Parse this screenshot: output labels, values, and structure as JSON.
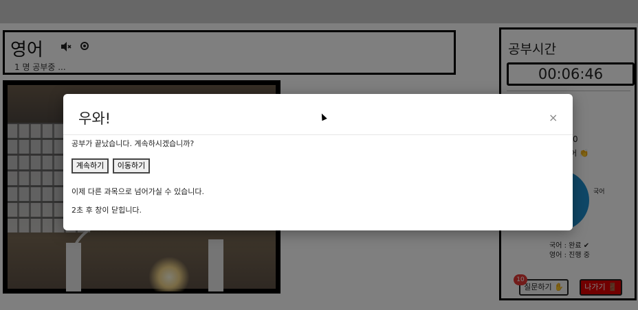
{
  "subject": {
    "title": "영어",
    "studying_count": "1 명 공부중 ..."
  },
  "right_panel": {
    "study_time_title": "공부시간",
    "timer": "00:06:46",
    "goal_number": "0",
    "goal_text": "어 👏",
    "pie_label": "국어",
    "legend": [
      "국어 : 완료 ✔",
      "영어 : 진행 중"
    ],
    "question_button": "질문하기 ✋",
    "question_badge": "10",
    "exit_button": "나가기 🚪"
  },
  "modal": {
    "title": "우와!",
    "close": "×",
    "question": "공부가 끝났습니다. 계속하시겠습니까?",
    "continue_button": "계속하기",
    "move_button": "이동하기",
    "info": "이제 다른 과목으로 넘어가실 수 있습니다.",
    "close_note": "2초 후 창이 닫힙니다."
  },
  "icons": {
    "mute": "speaker-muted-icon",
    "record": "record-icon",
    "cursor": "mouse-pointer-icon"
  },
  "colors": {
    "pie": "#1f8fce",
    "exit": "#e30000",
    "badge": "#e53935"
  }
}
